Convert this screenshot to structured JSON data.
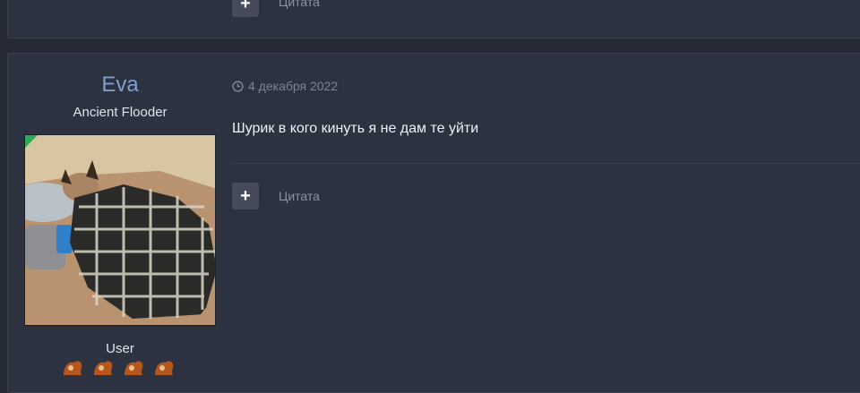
{
  "previous_post": {
    "quote_label": "Цитата"
  },
  "post": {
    "author": {
      "name": "Eva",
      "title": "Ancient Flooder",
      "group": "User"
    },
    "date": "4 декабря 2022",
    "text": "Шурик в кого кинуть я не дам те уйти",
    "quote_label": "Цитата",
    "rank_icons": [
      "rank-icon",
      "rank-icon",
      "rank-icon",
      "rank-icon"
    ]
  },
  "colors": {
    "background": "#252a34",
    "post_bg": "#2d3240",
    "author_name": "#7f9fcf",
    "online": "#2ea85b"
  }
}
